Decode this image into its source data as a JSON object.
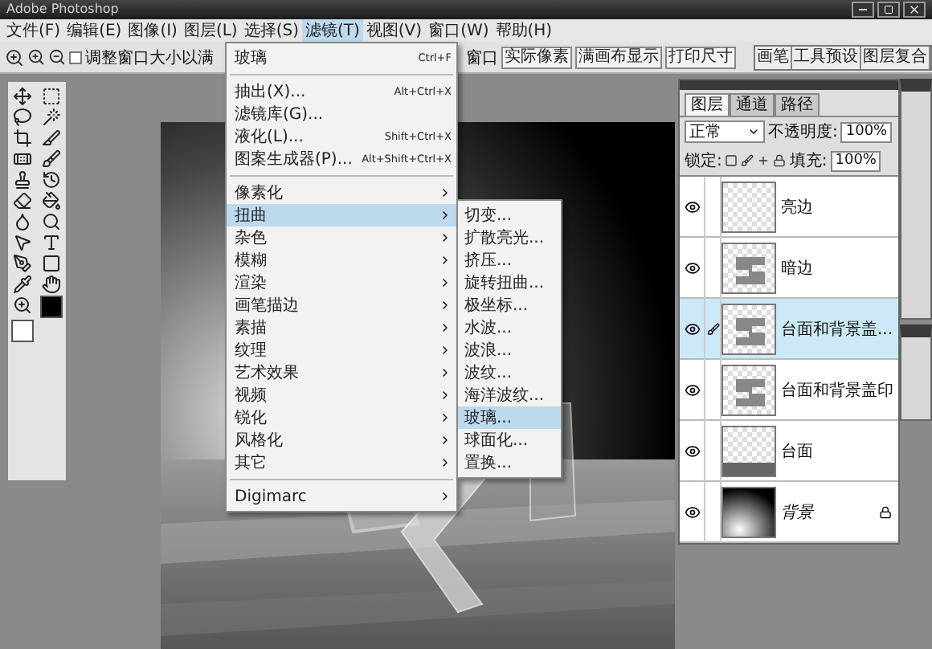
{
  "window": {
    "title": "Adobe Photoshop"
  },
  "menu_bar": [
    {
      "label": "文件(F)",
      "selected": false
    },
    {
      "label": "编辑(E)",
      "selected": false
    },
    {
      "label": "图像(I)",
      "selected": false
    },
    {
      "label": "图层(L)",
      "selected": false
    },
    {
      "label": "选择(S)",
      "selected": false
    },
    {
      "label": "滤镜(T)",
      "selected": true
    },
    {
      "label": "视图(V)",
      "selected": false
    },
    {
      "label": "窗口(W)",
      "selected": false
    },
    {
      "label": "帮助(H)",
      "selected": false
    }
  ],
  "options_bar": {
    "checkbox": {
      "label": "调整窗口大小以满",
      "checked": false
    },
    "trailing_label": "窗口",
    "buttons": [
      "实际像素",
      "满画布显示",
      "打印尺寸"
    ]
  },
  "palette_well": {
    "tabs": [
      "画笔",
      "工具预设",
      "图层复合"
    ]
  },
  "filter_menu": {
    "items": [
      {
        "kind": "item",
        "label": "玻璃",
        "shortcut": "Ctrl+F",
        "submenu": false,
        "selected": false
      },
      {
        "kind": "separator"
      },
      {
        "kind": "item",
        "label": "抽出(X)...",
        "shortcut": "Alt+Ctrl+X",
        "submenu": false,
        "selected": false
      },
      {
        "kind": "item",
        "label": "滤镜库(G)...",
        "submenu": false,
        "selected": false
      },
      {
        "kind": "item",
        "label": "液化(L)...",
        "shortcut": "Shift+Ctrl+X",
        "submenu": false,
        "selected": false
      },
      {
        "kind": "item",
        "label": "图案生成器(P)...",
        "shortcut": "Alt+Shift+Ctrl+X",
        "submenu": false,
        "selected": false
      },
      {
        "kind": "separator"
      },
      {
        "kind": "item",
        "label": "像素化",
        "submenu": true,
        "selected": false
      },
      {
        "kind": "item",
        "label": "扭曲",
        "submenu": true,
        "selected": true
      },
      {
        "kind": "item",
        "label": "杂色",
        "submenu": true,
        "selected": false
      },
      {
        "kind": "item",
        "label": "模糊",
        "submenu": true,
        "selected": false
      },
      {
        "kind": "item",
        "label": "渲染",
        "submenu": true,
        "selected": false
      },
      {
        "kind": "item",
        "label": "画笔描边",
        "submenu": true,
        "selected": false
      },
      {
        "kind": "item",
        "label": "素描",
        "submenu": true,
        "selected": false
      },
      {
        "kind": "item",
        "label": "纹理",
        "submenu": true,
        "selected": false
      },
      {
        "kind": "item",
        "label": "艺术效果",
        "submenu": true,
        "selected": false
      },
      {
        "kind": "item",
        "label": "视频",
        "submenu": true,
        "selected": false
      },
      {
        "kind": "item",
        "label": "锐化",
        "submenu": true,
        "selected": false
      },
      {
        "kind": "item",
        "label": "风格化",
        "submenu": true,
        "selected": false
      },
      {
        "kind": "item",
        "label": "其它",
        "submenu": true,
        "selected": false
      },
      {
        "kind": "separator"
      },
      {
        "kind": "item",
        "label": "Digimarc",
        "submenu": true,
        "selected": false
      }
    ],
    "submenu": [
      {
        "label": "切变...",
        "selected": false
      },
      {
        "label": "扩散亮光...",
        "selected": false
      },
      {
        "label": "挤压...",
        "selected": false
      },
      {
        "label": "旋转扭曲...",
        "selected": false
      },
      {
        "label": "极坐标...",
        "selected": false
      },
      {
        "label": "水波...",
        "selected": false
      },
      {
        "label": "波浪...",
        "selected": false
      },
      {
        "label": "波纹...",
        "selected": false
      },
      {
        "label": "海洋波纹...",
        "selected": false
      },
      {
        "label": "玻璃...",
        "selected": true
      },
      {
        "label": "球面化...",
        "selected": false
      },
      {
        "label": "置换...",
        "selected": false
      }
    ]
  },
  "layers_panel": {
    "tabs": [
      {
        "label": "图层",
        "selected": true
      },
      {
        "label": "通道",
        "selected": false
      },
      {
        "label": "路径",
        "selected": false
      }
    ],
    "blend_mode": "正常",
    "opacity_label": "不透明度:",
    "opacity": "100%",
    "lock_label": "锁定:",
    "fill_label": "填充:",
    "fill": "100%",
    "layers": [
      {
        "name": "亮边",
        "kind": "transparent",
        "visible": true,
        "selected": false,
        "locked": false
      },
      {
        "name": "暗边",
        "kind": "glyph",
        "visible": true,
        "selected": false,
        "locked": false
      },
      {
        "name": "台面和背景盖...",
        "kind": "glyph",
        "visible": true,
        "selected": true,
        "locked": false
      },
      {
        "name": "台面和背景盖印",
        "kind": "glyph",
        "visible": true,
        "selected": false,
        "locked": false
      },
      {
        "name": "台面",
        "kind": "floor",
        "visible": true,
        "selected": false,
        "locked": false
      },
      {
        "name": "背景",
        "kind": "gradient",
        "visible": true,
        "selected": false,
        "locked": true
      }
    ]
  }
}
